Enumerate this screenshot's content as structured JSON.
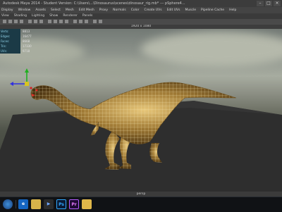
{
  "window": {
    "title": "Autodesk Maya 2014 - Student Version: C:\\Users\\...\\Dinosaurus\\scenes\\dinosaur_rig.mb* --- pSphere4...",
    "controls": [
      "–",
      "□",
      "×"
    ]
  },
  "menubar": {
    "items": [
      "Display",
      "Window",
      "Assets",
      "Select",
      "Mesh",
      "Edit Mesh",
      "Proxy",
      "Normals",
      "Color",
      "Create UVs",
      "Edit UVs",
      "Muscle",
      "Pipeline Cache",
      "Help"
    ]
  },
  "panel_menu": {
    "items": [
      "View",
      "Shading",
      "Lighting",
      "Show",
      "Renderer",
      "Panels"
    ]
  },
  "viewport": {
    "header": "1920 x 1080",
    "footer": "persp"
  },
  "hud": {
    "rows": [
      {
        "label": "Verts:",
        "value": "8813"
      },
      {
        "label": "Edges:",
        "value": "16477"
      },
      {
        "label": "Faces:",
        "value": "8668"
      },
      {
        "label": "Tris:",
        "value": "17330"
      },
      {
        "label": "UVs:",
        "value": "9718"
      }
    ]
  },
  "colors": {
    "hud_label_bg": "#1b3a46",
    "creature_body": "#8d6a2c",
    "wireframe": "#e8d7a0",
    "floor": "#2e2e2e"
  },
  "taskbar": {
    "items": [
      {
        "name": "start-icon",
        "label": ""
      },
      {
        "name": "ie-icon",
        "label": "e"
      },
      {
        "name": "explorer-icon",
        "label": ""
      },
      {
        "name": "media-icon",
        "label": "▶"
      },
      {
        "name": "photoshop-icon",
        "label": "Ps"
      },
      {
        "name": "premiere-icon",
        "label": "Pr"
      },
      {
        "name": "folder-icon",
        "label": ""
      }
    ]
  }
}
